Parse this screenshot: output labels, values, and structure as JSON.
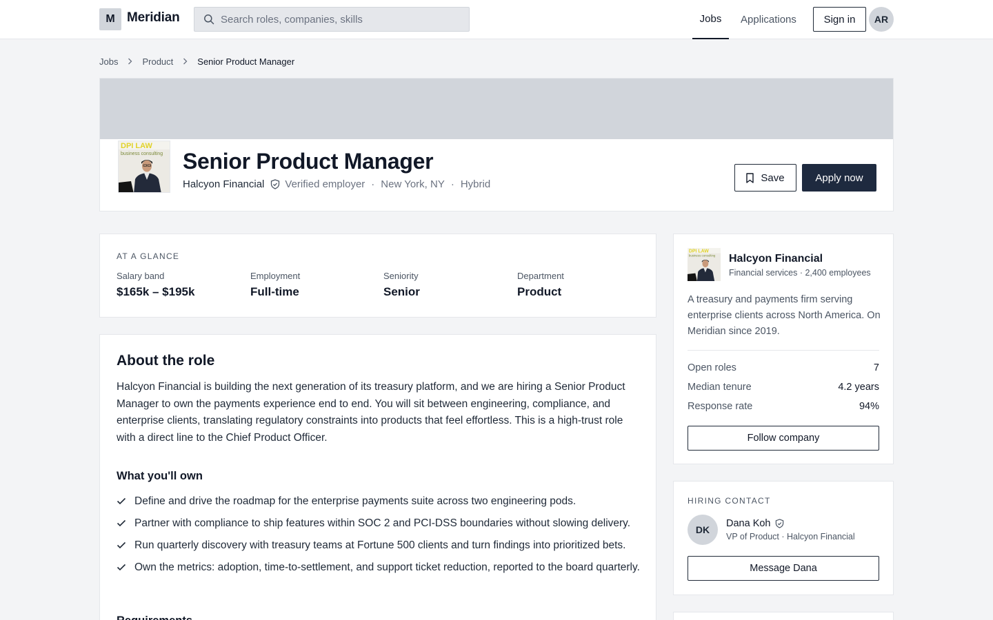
{
  "nav": {
    "logo_mark": "M",
    "brand": "Meridian",
    "search_placeholder": "Search roles, companies, skills",
    "links": {
      "jobs": "Jobs",
      "applications": "Applications"
    },
    "sign_in": "Sign in",
    "avatar_initials": "AR"
  },
  "breadcrumb": [
    "Jobs",
    "Product",
    "Senior Product Manager"
  ],
  "job": {
    "title": "Senior Product Manager",
    "company": "Halcyon Financial",
    "verified_label": "Verified employer",
    "location": "New York, NY",
    "work_mode": "Hybrid",
    "save_label": "Save",
    "apply_label": "Apply now"
  },
  "glance": {
    "heading": "At a glance",
    "items": [
      {
        "label": "Salary band",
        "value": "$165k – $195k"
      },
      {
        "label": "Employment",
        "value": "Full-time"
      },
      {
        "label": "Seniority",
        "value": "Senior"
      },
      {
        "label": "Department",
        "value": "Product"
      }
    ]
  },
  "about": {
    "heading": "About the role",
    "paragraph": "Halcyon Financial is building the next generation of its treasury platform, and we are hiring a Senior Product Manager to own the payments experience end to end. You will sit between engineering, compliance, and enterprise clients, translating regulatory constraints into products that feel effortless. This is a high-trust role with a direct line to the Chief Product Officer.",
    "own_heading": "What you'll own",
    "own_items": [
      "Define and drive the roadmap for the enterprise payments suite across two engineering pods.",
      "Partner with compliance to ship features within SOC 2 and PCI-DSS boundaries without slowing delivery.",
      "Run quarterly discovery with treasury teams at Fortune 500 clients and turn findings into prioritized bets.",
      "Own the metrics: adoption, time-to-settlement, and support ticket reduction, reported to the board quarterly."
    ],
    "next_heading": "Requirements"
  },
  "company": {
    "name": "Halcyon Financial",
    "subtitle": "Financial services · 2,400 employees",
    "description": "A treasury and payments firm serving enterprise clients across North America. On Meridian since 2019.",
    "stats": [
      {
        "label": "Open roles",
        "value": "7"
      },
      {
        "label": "Median tenure",
        "value": "4.2 years"
      },
      {
        "label": "Response rate",
        "value": "94%"
      }
    ],
    "follow_label": "Follow company"
  },
  "contact": {
    "heading": "Hiring contact",
    "initials": "DK",
    "name": "Dana Koh",
    "role": "VP of Product · Halcyon Financial",
    "message_label": "Message Dana"
  },
  "logo_image": {
    "text_top": "DPI LAW",
    "text_sub": "business consulting"
  },
  "colors": {
    "primary_button": "#1e2a3f",
    "banner": "#d1d5db",
    "page_bg": "#f3f4f6"
  }
}
